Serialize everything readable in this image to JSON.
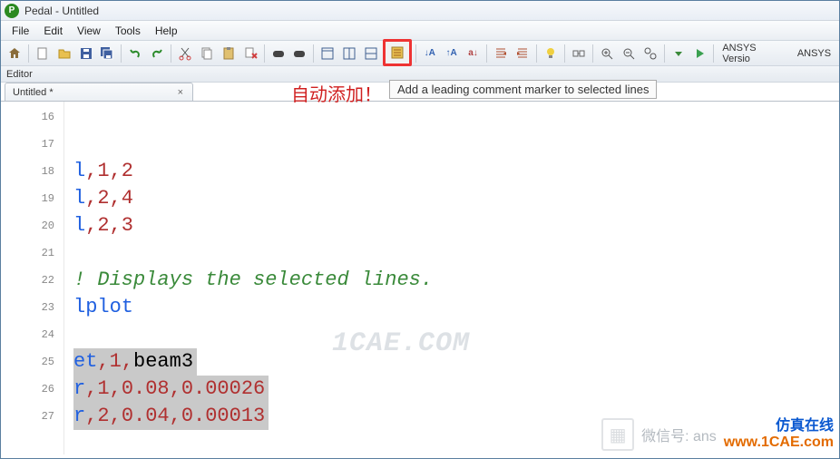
{
  "window": {
    "title": "Pedal - Untitled",
    "app_letter": "P"
  },
  "menu": {
    "file": "File",
    "edit": "Edit",
    "view": "View",
    "tools": "Tools",
    "help": "Help"
  },
  "toolbar_text": {
    "ansys_version": "ANSYS Versio",
    "ansys": "ANSYS"
  },
  "editor_panel_label": "Editor",
  "tab": {
    "label": "Untitled *",
    "close": "×"
  },
  "annotation": {
    "text": "自动添加！",
    "tooltip": "Add a leading comment marker to selected lines"
  },
  "gutter": [
    "16",
    "17",
    "18",
    "19",
    "20",
    "21",
    "22",
    "23",
    "24",
    "25",
    "26",
    "27"
  ],
  "code": {
    "l18": {
      "cmd": "l",
      "args": ",1,2"
    },
    "l19": {
      "cmd": "l",
      "args": ",2,4"
    },
    "l20": {
      "cmd": "l",
      "args": ",2,3"
    },
    "l22": "! Displays the selected lines.",
    "l23": "lplot",
    "l25": {
      "cmd": "et",
      "a1": ",1,",
      "a2": "beam3"
    },
    "l26": {
      "cmd": "r",
      "a1": ",1,",
      "a2": "0.08",
      "a3": ",",
      "a4": "0.00026"
    },
    "l27": {
      "cmd": "r",
      "a1": ",2,",
      "a2": "0.04",
      "a3": ",",
      "a4": "0.00013"
    }
  },
  "watermark": {
    "center": "1CAE.COM",
    "cn_label": "仿真在线",
    "weixin_label": "微信号: ans",
    "url": "www.1CAE.com"
  }
}
